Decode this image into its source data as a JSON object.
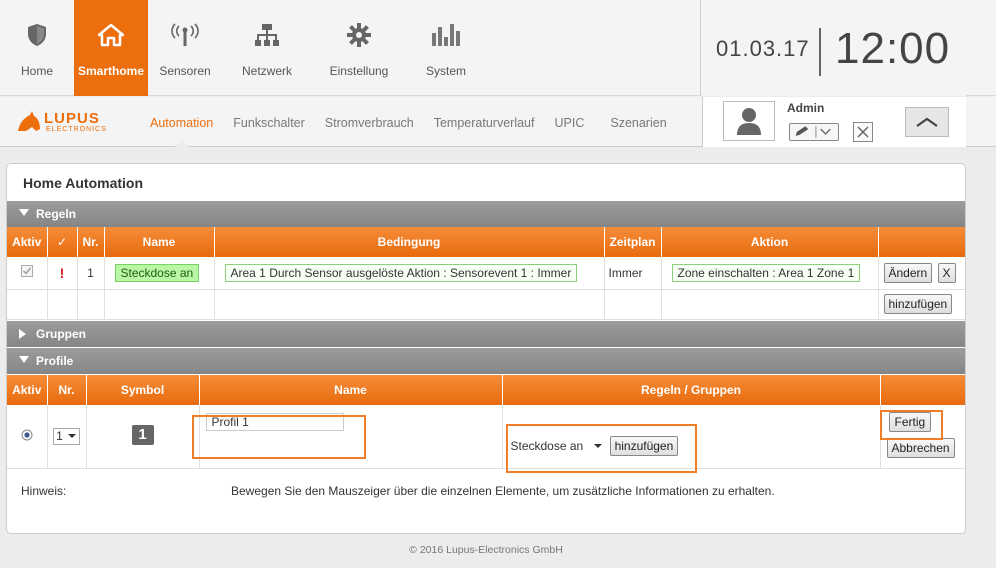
{
  "nav": {
    "items": [
      {
        "label": "Home",
        "icon": "shield-icon",
        "active": false
      },
      {
        "label": "Smarthome",
        "icon": "house-icon",
        "active": true
      },
      {
        "label": "Sensoren",
        "icon": "antenna-icon",
        "active": false
      },
      {
        "label": "Netzwerk",
        "icon": "network-icon",
        "active": false
      },
      {
        "label": "Einstellung",
        "icon": "gear-icon",
        "active": false
      },
      {
        "label": "System",
        "icon": "equalizer-icon",
        "active": false
      }
    ]
  },
  "clock": {
    "date": "01.03.17",
    "time": "12:00"
  },
  "subnav": {
    "items": [
      "Automation",
      "Funkschalter",
      "Stromverbrauch",
      "Temperaturverlauf",
      "UPIC",
      "Szenarien"
    ],
    "active": "Automation"
  },
  "brand": {
    "name": "LUPUS",
    "sub": "ELECTRONICS",
    "color": "#ec6e0d"
  },
  "user": {
    "name": "Admin"
  },
  "main": {
    "title": "Home Automation"
  },
  "rules": {
    "section_label": "Regeln",
    "headers": [
      "Aktiv",
      "✓",
      "Nr.",
      "Name",
      "Bedingung",
      "Zeitplan",
      "Aktion"
    ],
    "row": {
      "nr": "1",
      "warn": "!",
      "name": "Steckdose an",
      "condition": "Area 1 Durch Sensor ausgelöste Aktion : Sensorevent 1 : Immer",
      "schedule": "Immer",
      "action": "Zone einschalten : Area 1 Zone 1",
      "edit_label": "Ändern",
      "delete_label": "X"
    },
    "add_label": "hinzufügen"
  },
  "groups": {
    "section_label": "Gruppen"
  },
  "profiles": {
    "section_label": "Profile",
    "headers": [
      "Aktiv",
      "Nr.",
      "Symbol",
      "Name",
      "Regeln / Gruppen"
    ],
    "row": {
      "nr": "1",
      "symbol": "1",
      "name_value": "Profil 1",
      "rule_select": "Steckdose an",
      "add_label": "hinzufügen",
      "done_label": "Fertig",
      "cancel_label": "Abbrechen"
    }
  },
  "hint": {
    "label": "Hinweis:",
    "text": "Bewegen Sie den Mauszeiger über die einzelnen Elemente, um zusätzliche Informationen zu erhalten."
  },
  "footer": {
    "text": "© 2016 Lupus-Electronics GmbH"
  },
  "colors": {
    "accent": "#ec6e0d",
    "highlight": "#ef7d2a",
    "section": "#8f8f8f"
  }
}
